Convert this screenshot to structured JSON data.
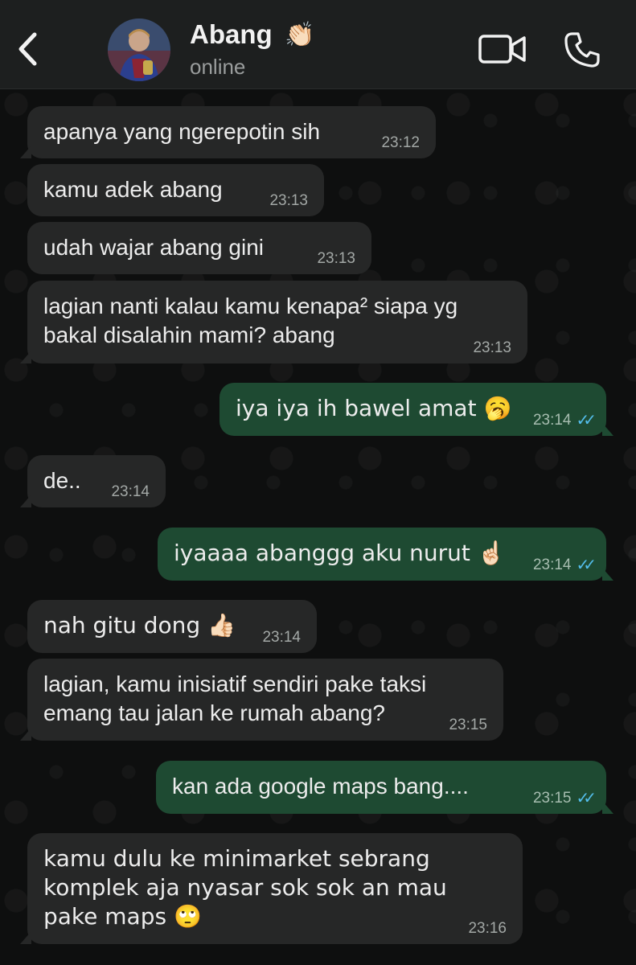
{
  "header": {
    "contact_name": "Abang",
    "name_emoji": "👏🏻",
    "status": "online"
  },
  "messages": [
    {
      "dir": "in",
      "text": "apanya yang ngerepotin sih",
      "time": "23:12"
    },
    {
      "dir": "in",
      "text": "kamu adek abang",
      "time": "23:13"
    },
    {
      "dir": "in",
      "text": "udah wajar abang gini",
      "time": "23:13"
    },
    {
      "dir": "in",
      "text": "lagian nanti kalau kamu kenapa² siapa yg bakal disalahin mami? abang",
      "time": "23:13"
    },
    {
      "dir": "out",
      "text": "iya iya ih bawel amat 🥱",
      "time": "23:14",
      "read": true
    },
    {
      "dir": "in",
      "text": "de..",
      "time": "23:14"
    },
    {
      "dir": "out",
      "text": "iyaaaa abanggg aku nurut ☝🏻",
      "time": "23:14",
      "read": true
    },
    {
      "dir": "in",
      "text": "nah gitu dong 👍🏻",
      "time": "23:14"
    },
    {
      "dir": "in",
      "text": "lagian, kamu inisiatif sendiri pake taksi emang tau jalan ke rumah abang?",
      "time": "23:15"
    },
    {
      "dir": "out",
      "text": "kan ada google maps bang....",
      "time": "23:15",
      "read": true
    },
    {
      "dir": "in",
      "text": "kamu dulu ke minimarket sebrang komplek aja nyasar sok sok an mau pake maps 🙄",
      "time": "23:16"
    }
  ],
  "icons": {
    "back": "chevron-left-icon",
    "video": "video-camera-icon",
    "call": "phone-icon",
    "read_receipt": "double-check-icon"
  },
  "colors": {
    "incoming_bubble": "#262727",
    "outgoing_bubble": "#1e4a32",
    "read_tick": "#53bdeb",
    "header_bg": "#1d1f1f"
  }
}
